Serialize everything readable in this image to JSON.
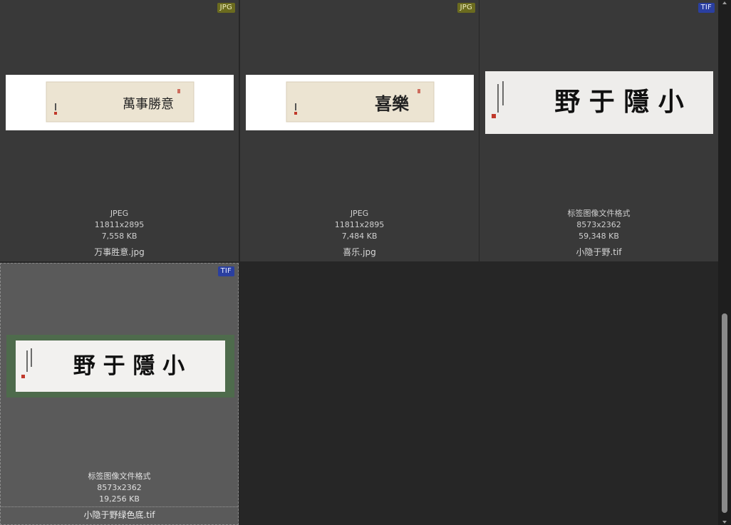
{
  "tiles": [
    {
      "badge": "JPG",
      "format": "JPEG",
      "dimensions": "11811x2895",
      "size": "7,558 KB",
      "filename": "万事胜意.jpg",
      "art_text": "萬事勝意"
    },
    {
      "badge": "JPG",
      "format": "JPEG",
      "dimensions": "11811x2895",
      "size": "7,484 KB",
      "filename": "喜乐.jpg",
      "art_text": "喜樂"
    },
    {
      "badge": "TIF",
      "format": "标签图像文件格式",
      "dimensions": "8573x2362",
      "size": "59,348 KB",
      "filename": "小隐于野.tif",
      "art_text": "野 于 隱 小"
    },
    {
      "badge": "TIF",
      "format": "标签图像文件格式",
      "dimensions": "8573x2362",
      "size": "19,256 KB",
      "filename": "小隐于野绿色底.tif",
      "art_text": "野 于 隱 小"
    }
  ],
  "colors": {
    "background": "#262626",
    "tile": "#393939",
    "tile_selected": "#5a5a5a",
    "badge_jpg": "#6b6b1f",
    "badge_tif": "#2a3fa0",
    "green_frame": "#4e6b4c"
  }
}
